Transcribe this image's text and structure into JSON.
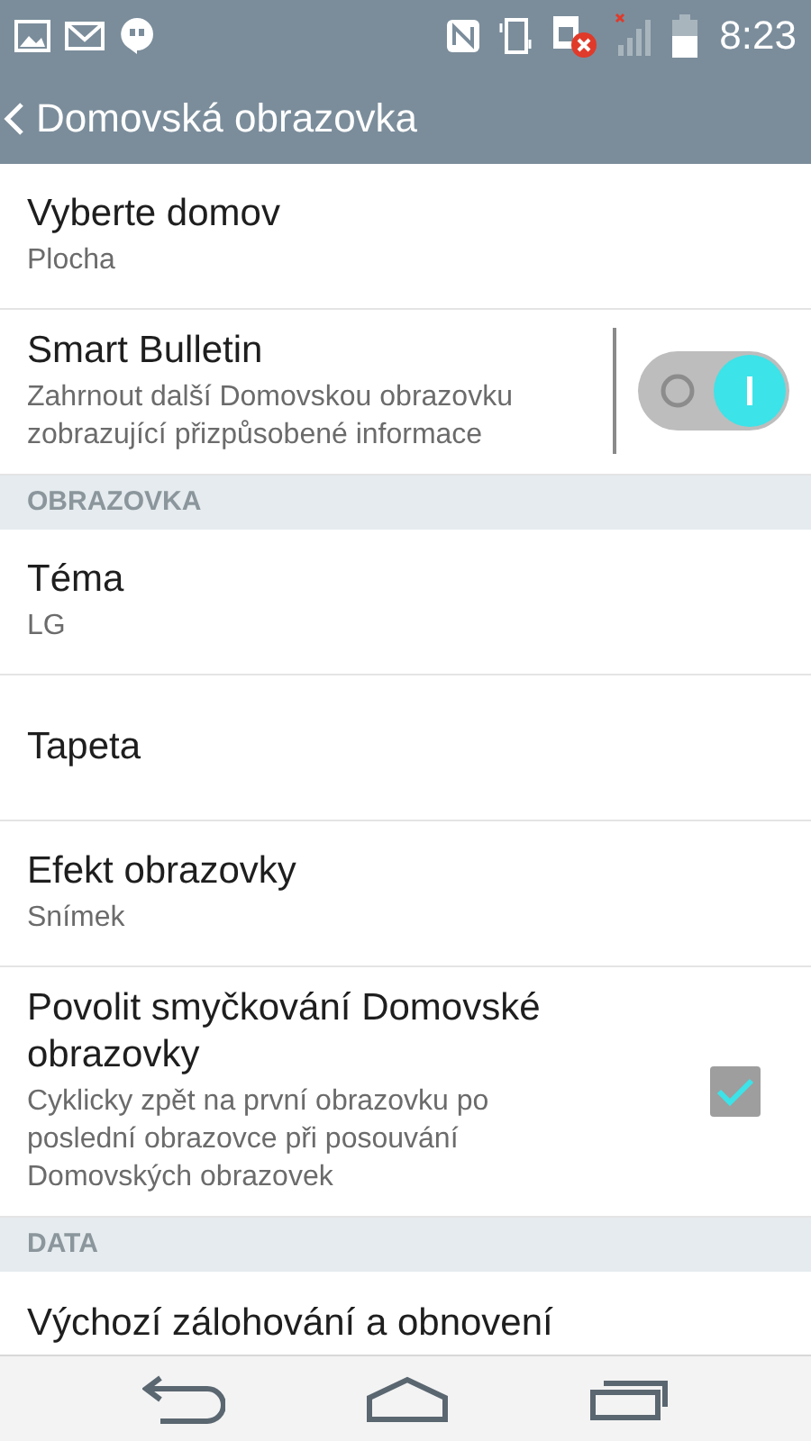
{
  "status_bar": {
    "time": "8:23"
  },
  "header": {
    "title": "Domovská obrazovka"
  },
  "items": [
    {
      "kind": "item",
      "title": "Vyberte domov",
      "summary": "Plocha"
    },
    {
      "kind": "toggle",
      "title": "Smart Bulletin",
      "summary": "Zahrnout další Domovskou obrazovku zobrazující přizpůsobené informace",
      "on": true
    },
    {
      "kind": "section",
      "title": "OBRAZOVKA"
    },
    {
      "kind": "item",
      "title": "Téma",
      "summary": "LG"
    },
    {
      "kind": "item",
      "title": "Tapeta"
    },
    {
      "kind": "item",
      "title": "Efekt obrazovky",
      "summary": "Snímek"
    },
    {
      "kind": "checkbox",
      "title": "Povolit smyčkování Domovské obrazovky",
      "summary": "Cyklicky zpět na první obrazovku po poslední obrazovce při posouvání Domovských obrazovek",
      "checked": true
    },
    {
      "kind": "section",
      "title": "DATA"
    },
    {
      "kind": "item",
      "title": "Výchozí zálohování a obnovení"
    }
  ]
}
